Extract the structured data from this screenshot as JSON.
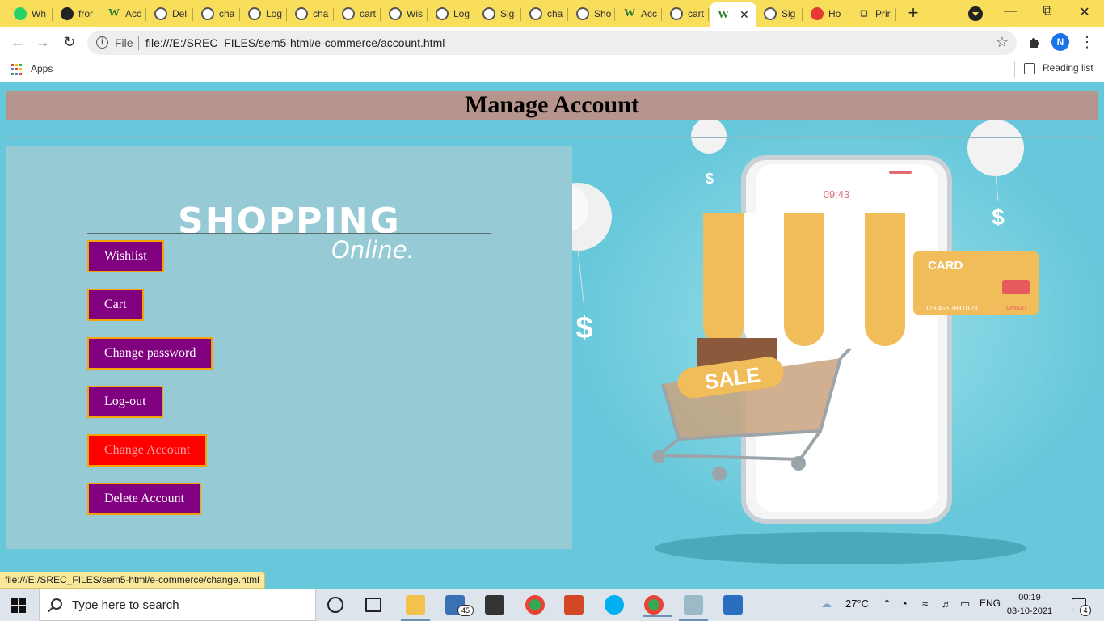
{
  "browser": {
    "tabs": [
      {
        "label": "Wh",
        "favicon": "whatsapp-icon"
      },
      {
        "label": "fror",
        "favicon": "github-icon"
      },
      {
        "label": "Acc",
        "favicon": "w3schools-icon"
      },
      {
        "label": "Del",
        "favicon": "globe-icon"
      },
      {
        "label": "cha",
        "favicon": "globe-icon"
      },
      {
        "label": "Log",
        "favicon": "globe-icon"
      },
      {
        "label": "cha",
        "favicon": "globe-icon"
      },
      {
        "label": "cart",
        "favicon": "globe-icon"
      },
      {
        "label": "Wis",
        "favicon": "globe-icon"
      },
      {
        "label": "Log",
        "favicon": "globe-icon"
      },
      {
        "label": "Sig",
        "favicon": "globe-icon"
      },
      {
        "label": "cha",
        "favicon": "globe-icon"
      },
      {
        "label": "Sho",
        "favicon": "globe-icon"
      },
      {
        "label": "Acc",
        "favicon": "w3schools-icon"
      },
      {
        "label": "cart",
        "favicon": "globe-icon"
      },
      {
        "label": "",
        "favicon": "w3schools-icon",
        "active": true
      },
      {
        "label": "Sig",
        "favicon": "globe-icon"
      },
      {
        "label": "Ho",
        "favicon": "red-icon"
      },
      {
        "label": "Prir",
        "favicon": "plug-icon"
      }
    ],
    "address": {
      "scheme_label": "File",
      "url": "file:///E:/SREC_FILES/sem5-html/e-commerce/account.html"
    },
    "profile_initial": "N",
    "bookmarks": {
      "apps_label": "Apps",
      "reading_list_label": "Reading list"
    },
    "status_url": "file:///E:/SREC_FILES/sem5-html/e-commerce/change.html",
    "accent_color": "#f9de5c"
  },
  "page": {
    "title": "Manage Account",
    "banner": {
      "title": "SHOPPING",
      "subtitle": "Online."
    },
    "menu": [
      {
        "label": "Wishlist",
        "name": "wishlist-button"
      },
      {
        "label": "Cart",
        "name": "cart-button"
      },
      {
        "label": "Change password",
        "name": "change-password-button"
      },
      {
        "label": "Log-out",
        "name": "logout-button"
      },
      {
        "label": "Change Account",
        "name": "change-account-button",
        "active": true
      },
      {
        "label": "Delete Account",
        "name": "delete-account-button"
      }
    ],
    "illustration": {
      "phone_time": "09:43",
      "card_label": "CARD",
      "card_number": "123 456 789 0123",
      "card_tag": "CREDIT",
      "sale_label": "SALE",
      "dollar": "$"
    },
    "colors": {
      "background": "#66c8da",
      "header": "#b5958c",
      "button": "#800080",
      "button_active": "#ff0000",
      "button_border": "#f5a300"
    }
  },
  "taskbar": {
    "search_placeholder": "Type here to search",
    "mail_badge": "45",
    "weather": "27°C",
    "language": "ENG",
    "time": "00:19",
    "date": "03-10-2021",
    "notification_count": "4"
  }
}
